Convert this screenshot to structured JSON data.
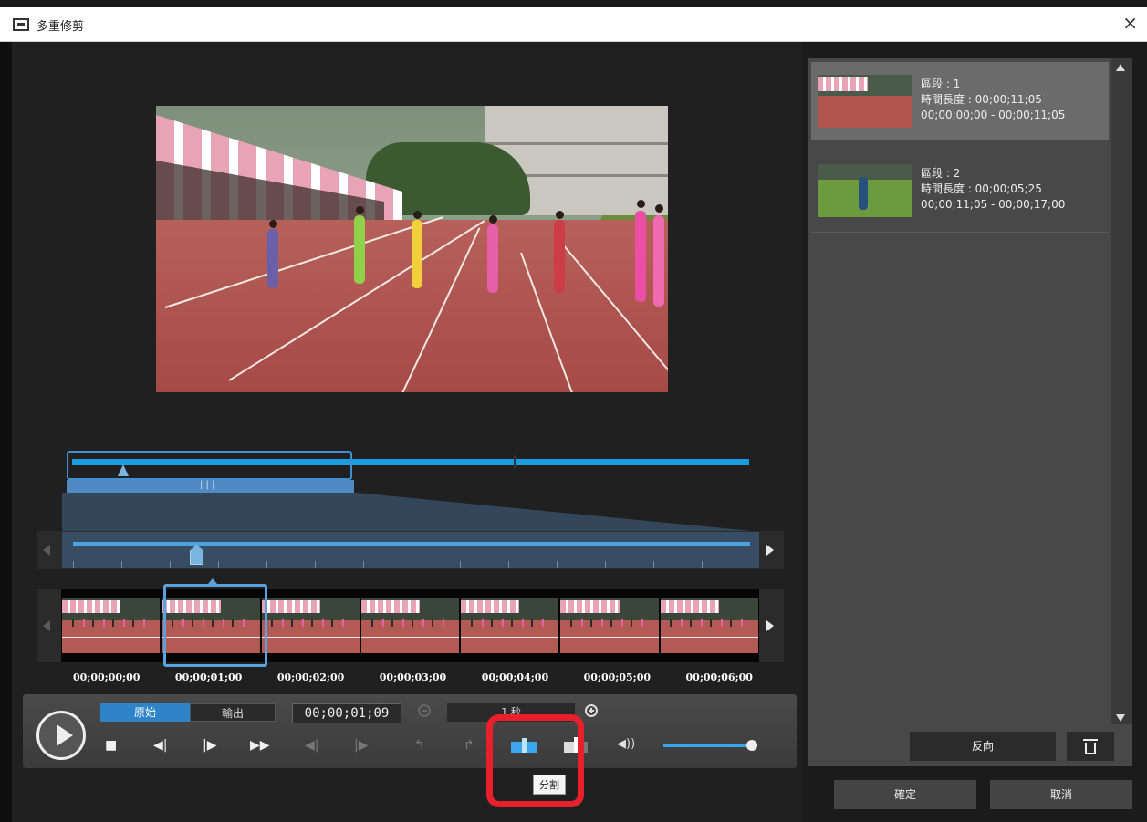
{
  "window": {
    "title": "多重修剪",
    "close_glyph": "×"
  },
  "editor": {
    "filmstrip_times": [
      "00;00;00;00",
      "00;00;01;00",
      "00;00;02;00",
      "00;00;03;00",
      "00;00;04;00",
      "00;00;05;00",
      "00;00;06;00"
    ]
  },
  "controls": {
    "tab_original": "原始",
    "tab_output": "輸出",
    "timecode": "00;00;01;09",
    "zoom_unit": "1 秒",
    "stop_glyph": "■",
    "prev_frame_glyph": "◀|",
    "next_frame_glyph": "|▶",
    "fast_forward_glyph": "▶▶",
    "mark_in_glyph": "◀|",
    "mark_out_glyph": "|▶",
    "go_in_glyph": "↰",
    "go_out_glyph": "↱",
    "volume_glyph": "◀))",
    "tooltip": "分割",
    "volume_level": 0.95
  },
  "clips": [
    {
      "label": "區段 : 1",
      "duration": "時間長度 : 00;00;11;05",
      "range": "00;00;00;00 - 00;00;11;05",
      "selected": true
    },
    {
      "label": "區段 : 2",
      "duration": "時間長度 : 00;00;05;25",
      "range": "00;00;11;05 - 00;00;17;00",
      "selected": false
    }
  ],
  "panel": {
    "reverse_label": "反向",
    "ok_label": "確定",
    "cancel_label": "取消"
  },
  "colors": {
    "accent": "#1a9ee0",
    "highlight": "#e8202c"
  }
}
